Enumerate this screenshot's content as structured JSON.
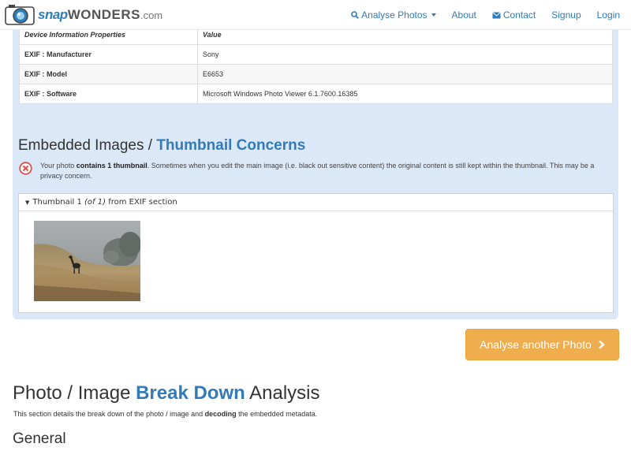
{
  "brand": {
    "snap": "snap",
    "wonders": "WONDERS",
    "com": ".com"
  },
  "nav": {
    "analyse": "Analyse Photos",
    "about": "About",
    "contact": "Contact",
    "signup": "Signup",
    "login": "Login"
  },
  "device_table": {
    "headers": [
      "Device Information Properties",
      "Value"
    ],
    "rows": [
      {
        "key": "EXIF : Manufacturer",
        "value": "Sony"
      },
      {
        "key": "EXIF : Model",
        "value": "E6653"
      },
      {
        "key": "EXIF : Software",
        "value": "Microsoft Windows Photo Viewer 6.1.7600.16385"
      }
    ]
  },
  "embedded": {
    "title_plain": "Embedded Images / ",
    "title_highlight": "Thumbnail Concerns",
    "warning_prefix": "Your photo ",
    "warning_bold": "contains 1 thumbnail",
    "warning_suffix": ". Sometimes when you edit the main image (i.e. black out sensitive content) the original content is still kept within the thumbnail. This may be a privacy concern.",
    "thumb_label": "Thumbnail 1",
    "thumb_count": "(of 1)",
    "thumb_source": "from EXIF section"
  },
  "button": {
    "analyse_another": "Analyse another Photo"
  },
  "breakdown": {
    "title_plain1": "Photo / Image ",
    "title_highlight": "Break Down",
    "title_plain2": " Analysis",
    "desc_prefix": "This section details the break down of the photo / image and ",
    "desc_bold": "decoding",
    "desc_suffix": " the embedded metadata.",
    "general": "General"
  },
  "colors": {
    "accent": "#337ab7",
    "panel": "#dbe8f8",
    "button": "#f0ad4e",
    "warning": "#d9534f"
  }
}
